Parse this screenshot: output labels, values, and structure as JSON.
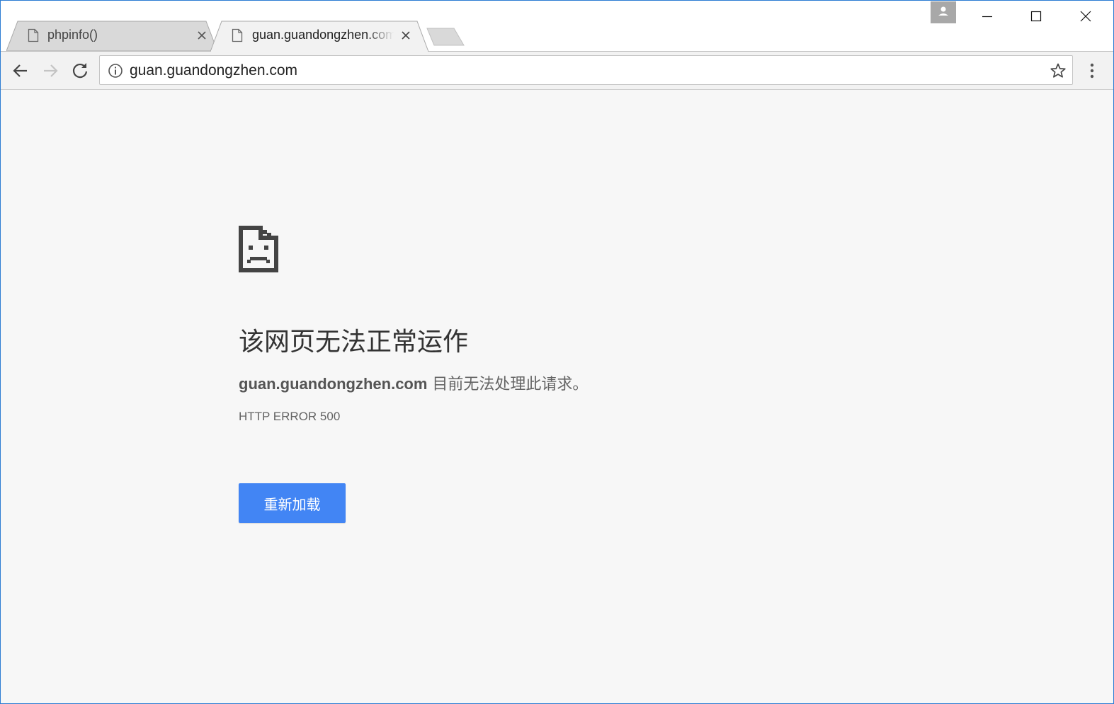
{
  "tabs": [
    {
      "title": "phpinfo()",
      "active": false
    },
    {
      "title": "guan.guandongzhen.com",
      "active": true
    }
  ],
  "toolbar": {
    "url": "guan.guandongzhen.com"
  },
  "error_page": {
    "heading": "该网页无法正常运作",
    "host": "guan.guandongzhen.com",
    "description": " 目前无法处理此请求。",
    "error_code": "HTTP ERROR 500",
    "reload_label": "重新加载"
  },
  "colors": {
    "accent": "#4285f4",
    "page_background": "#f7f7f7",
    "window_border": "#2b7cd3"
  },
  "icons": {
    "tab_page": "page-icon",
    "tab_close": "close-icon",
    "back": "back-arrow-icon",
    "forward": "forward-arrow-icon",
    "reload": "reload-icon",
    "site_info": "info-icon",
    "bookmark": "star-icon",
    "menu": "more-vert-icon",
    "profile": "person-icon",
    "error": "sad-page-icon"
  }
}
